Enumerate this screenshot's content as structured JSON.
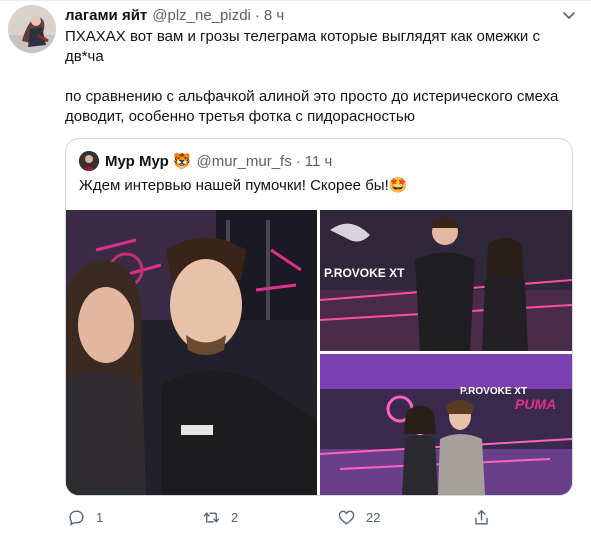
{
  "tweet": {
    "author_name": "лагами яйт",
    "handle": "@plz_ne_pizdi",
    "separator": "·",
    "time": "8 ч",
    "paragraphs": [
      "ПХАХАХ вот вам и грозы телеграма которые выглядят как омежки с дв*ча",
      "по сравнению с альфачкой алиной это просто до истерического смеха доводит, особенно третья фотка с пидорасностью"
    ]
  },
  "quote": {
    "author_name": "Мур Мур",
    "author_emoji": "🐯",
    "handle": "@mur_mur_fs",
    "separator": "·",
    "time": "11 ч",
    "text": "Ждем интервью нашей пумочки! Скорее бы!",
    "text_emoji": "🤩",
    "photos": {
      "photo2_sign": "P.ROVOKE XT",
      "photo3_sign_left": "P.ROVOKE XT",
      "photo3_sign_right": "PUMA"
    }
  },
  "actions": {
    "reply_count": "1",
    "retweet_count": "2",
    "like_count": "22",
    "icons": [
      "reply-icon",
      "retweet-icon",
      "like-icon",
      "share-icon"
    ]
  },
  "colors": {
    "text": "#0f1419",
    "secondary": "#536471",
    "border": "#cfd9de"
  }
}
